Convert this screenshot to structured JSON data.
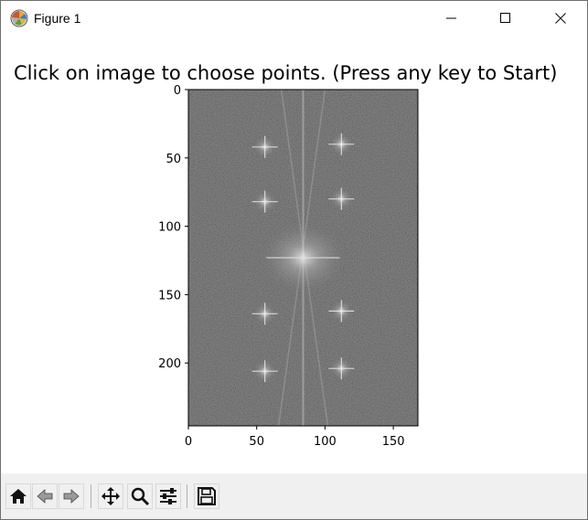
{
  "window": {
    "title": "Figure 1",
    "icons": {
      "app": "matplotlib-logo-icon",
      "minimize": "minimize-icon",
      "maximize": "maximize-icon",
      "close": "close-icon"
    }
  },
  "figure": {
    "title": "Click on image to choose points. (Press any key to Start)"
  },
  "chart_data": {
    "type": "heatmap",
    "description_kind": "image",
    "title": "Click on image to choose points. (Press any key to Start)",
    "xlabel": "",
    "ylabel": "",
    "xlim": [
      0,
      168
    ],
    "ylim": [
      246,
      0
    ],
    "xticks": [
      0,
      50,
      100,
      150
    ],
    "yticks": [
      0,
      50,
      100,
      150,
      200
    ],
    "xtick_labels": [
      "0",
      "50",
      "100",
      "150"
    ],
    "ytick_labels": [
      "0",
      "50",
      "100",
      "150",
      "200"
    ],
    "grid": false,
    "colormap": "gray",
    "bright_features": [
      {
        "x": 84,
        "y": 123,
        "kind": "center-peak"
      },
      {
        "x": 56,
        "y": 82
      },
      {
        "x": 112,
        "y": 80
      },
      {
        "x": 56,
        "y": 164
      },
      {
        "x": 112,
        "y": 162
      },
      {
        "x": 56,
        "y": 42
      },
      {
        "x": 112,
        "y": 40
      },
      {
        "x": 56,
        "y": 206
      },
      {
        "x": 112,
        "y": 204
      }
    ],
    "vertical_streak_x": 84
  },
  "toolbar": {
    "buttons": [
      {
        "name": "home-button",
        "icon": "home-icon"
      },
      {
        "name": "back-button",
        "icon": "back-arrow-icon"
      },
      {
        "name": "forward-button",
        "icon": "forward-arrow-icon"
      },
      {
        "name": "pan-button",
        "icon": "move-icon"
      },
      {
        "name": "zoom-button",
        "icon": "zoom-icon"
      },
      {
        "name": "configure-subplots-button",
        "icon": "sliders-icon"
      },
      {
        "name": "save-button",
        "icon": "floppy-disk-icon"
      }
    ]
  }
}
